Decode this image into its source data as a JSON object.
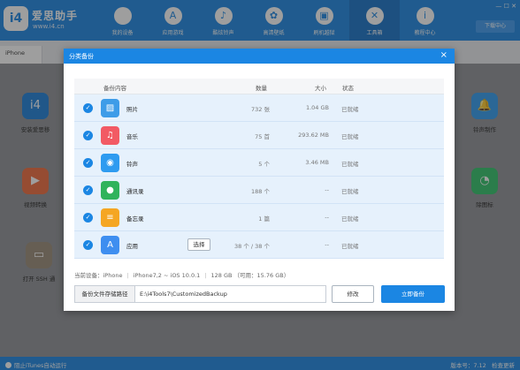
{
  "app": {
    "logo_text": "i4",
    "brand_name": "爱思助手",
    "brand_url": "www.i4.cn",
    "nav": [
      {
        "label": "我的设备",
        "icon": "apple-icon",
        "glyph": ""
      },
      {
        "label": "应用游戏",
        "icon": "app-store-icon",
        "glyph": "A"
      },
      {
        "label": "酷炫铃声",
        "icon": "bell-icon",
        "glyph": "♪"
      },
      {
        "label": "高清壁纸",
        "icon": "gear-wallpaper-icon",
        "glyph": "✿"
      },
      {
        "label": "刷机越狱",
        "icon": "box-icon",
        "glyph": "▣"
      },
      {
        "label": "工具箱",
        "icon": "tools-icon",
        "glyph": "✕"
      },
      {
        "label": "教程中心",
        "icon": "info-icon",
        "glyph": "i"
      }
    ],
    "window_controls": "— ☐ ✕",
    "download_button": "下载中心",
    "tab_label": "iPhone",
    "tools": [
      {
        "label": "安装爱思移",
        "glyph": "i4",
        "color": "#1a7ed9"
      },
      {
        "label": "视频转换",
        "glyph": "▶",
        "color": "#f06a3b"
      },
      {
        "label": "打开 SSH 通",
        "glyph": "▭",
        "color": "#9a8a77"
      },
      {
        "label": "铃声制作",
        "glyph": "🔔",
        "color": "#2e9bf0"
      },
      {
        "label": "除图标",
        "glyph": "◔",
        "color": "#2fc468"
      }
    ],
    "status_left": "阻止iTunes自动运行",
    "status_right": "版本号：7.12",
    "status_right_extra": "检查更新"
  },
  "dialog": {
    "title": "分类备份",
    "close_icon": "×",
    "header": {
      "content": "备份内容",
      "count": "数量",
      "size": "大小",
      "status": "状态"
    },
    "rows": [
      {
        "name": "照片",
        "count": "732 张",
        "size": "1.04 GB",
        "status": "已就绪",
        "glyph": "▨",
        "color": "#3e9ce8",
        "icon": "photo-icon"
      },
      {
        "name": "音乐",
        "count": "75 首",
        "size": "293.62 MB",
        "status": "已就绪",
        "glyph": "♫",
        "color": "#f25a64",
        "icon": "music-icon"
      },
      {
        "name": "铃声",
        "count": "5 个",
        "size": "3.46 MB",
        "status": "已就绪",
        "glyph": "◉",
        "color": "#2e9bf0",
        "icon": "ringtone-icon"
      },
      {
        "name": "通讯录",
        "count": "188 个",
        "size": "--",
        "status": "已就绪",
        "glyph": "●",
        "color": "#30b35c",
        "icon": "contacts-icon"
      },
      {
        "name": "备忘录",
        "count": "1 篇",
        "size": "--",
        "status": "已就绪",
        "glyph": "≡",
        "color": "#f5a623",
        "icon": "notes-icon"
      },
      {
        "name": "应用",
        "count": "38 个 / 38 个",
        "size": "--",
        "status": "已就绪",
        "glyph": "A",
        "color": "#3e8ef0",
        "icon": "app-icon",
        "action": "选择"
      }
    ],
    "device_info": {
      "label": "当前设备：",
      "device": "iPhone",
      "model": "iPhone7,2 ~ iOS 10.0.1",
      "storage": "128 GB （可用：15.76 GB）"
    },
    "path_label": "备份文件存储路径",
    "path_value": "E:\\i4Tools7\\CustomizedBackup",
    "modify_button": "修改",
    "backup_button": "立即备份"
  }
}
